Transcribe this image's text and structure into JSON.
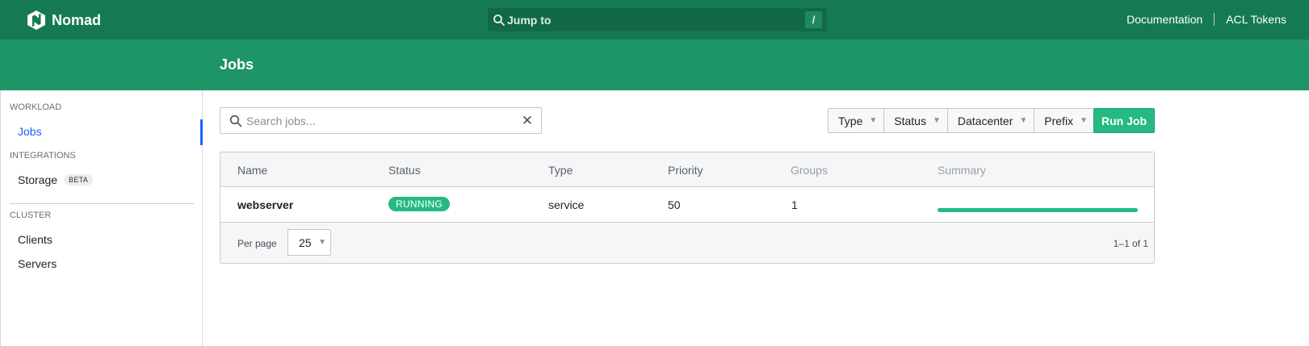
{
  "app": {
    "name": "Nomad"
  },
  "topnav": {
    "jump_label": "Jump to",
    "jump_key": "/",
    "links": [
      "Documentation",
      "ACL Tokens"
    ]
  },
  "page": {
    "title": "Jobs"
  },
  "sidebar": {
    "sections": [
      {
        "label": "WORKLOAD",
        "items": [
          {
            "label": "Jobs",
            "active": true
          }
        ]
      },
      {
        "label": "INTEGRATIONS",
        "items": [
          {
            "label": "Storage",
            "badge": "BETA"
          }
        ]
      },
      {
        "label": "CLUSTER",
        "items": [
          {
            "label": "Clients"
          },
          {
            "label": "Servers"
          }
        ]
      }
    ]
  },
  "toolbar": {
    "search_placeholder": "Search jobs...",
    "filters": [
      "Type",
      "Status",
      "Datacenter",
      "Prefix"
    ],
    "run_job_label": "Run Job"
  },
  "table": {
    "columns": [
      "Name",
      "Status",
      "Type",
      "Priority",
      "Groups",
      "Summary"
    ],
    "rows": [
      {
        "name": "webserver",
        "status": "RUNNING",
        "type": "service",
        "priority": "50",
        "groups": "1",
        "summary_fraction": 1.0
      }
    ],
    "per_page_label": "Per page",
    "per_page_value": "25",
    "pager_info": "1–1 of 1"
  },
  "colors": {
    "topnav_bg": "#157a52",
    "subnav_bg": "#1e9566",
    "accent_green": "#25ba81",
    "active_blue": "#1563ff"
  }
}
